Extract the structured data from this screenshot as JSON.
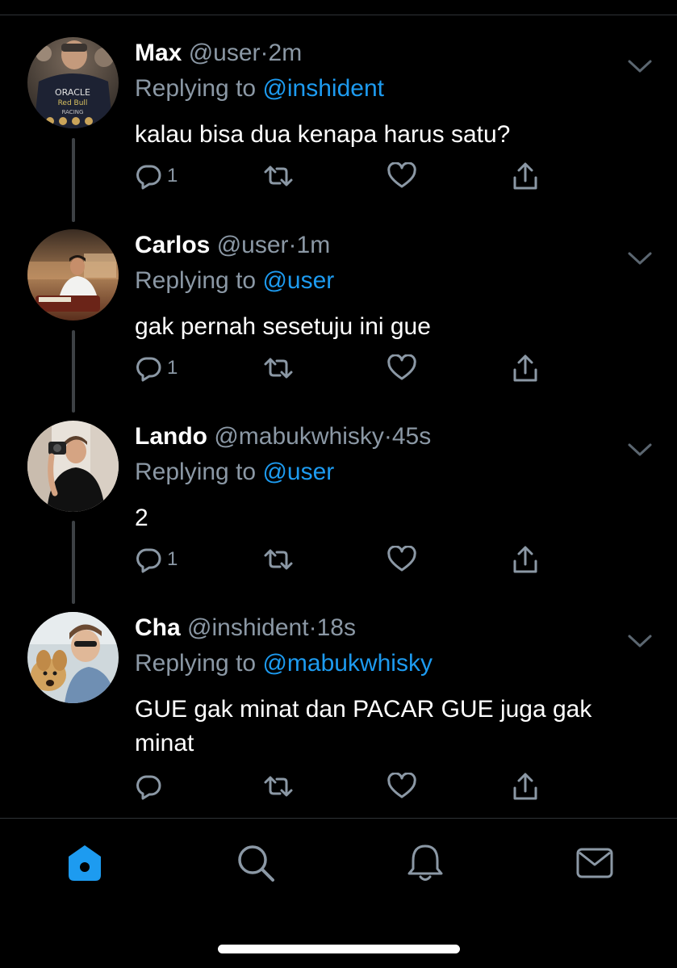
{
  "tweets": [
    {
      "name": "Max",
      "handle": "@user",
      "separator": "·",
      "time": "2m",
      "replying_prefix": "Replying to ",
      "replying_to": "@inshident",
      "text": "kalau bisa dua kenapa harus satu?",
      "reply_count": "1",
      "avatar": "avatar-max"
    },
    {
      "name": "Carlos",
      "handle": "@user",
      "separator": "·",
      "time": "1m",
      "replying_prefix": "Replying to ",
      "replying_to": "@user",
      "text": "gak pernah sesetuju ini gue",
      "reply_count": "1",
      "avatar": "avatar-carlos"
    },
    {
      "name": "Lando",
      "handle": "@mabukwhisky",
      "separator": "·",
      "time": "45s",
      "replying_prefix": "Replying to ",
      "replying_to": "@user",
      "text": "2",
      "reply_count": "1",
      "avatar": "avatar-lando"
    },
    {
      "name": "Cha",
      "handle": "@inshident",
      "separator": "·",
      "time": "18s",
      "replying_prefix": "Replying to ",
      "replying_to": "@mabukwhisky",
      "text": "GUE gak minat dan PACAR GUE juga gak minat",
      "reply_count": "",
      "avatar": "avatar-cha"
    }
  ],
  "icons": {
    "reply": "reply-icon",
    "retweet": "retweet-icon",
    "like": "heart-icon",
    "share": "share-icon",
    "more": "chevron-down-icon"
  },
  "tabbar": {
    "items": [
      "home-icon",
      "search-icon",
      "notifications-icon",
      "messages-icon"
    ],
    "active": "home-icon"
  },
  "colors": {
    "background": "#000000",
    "text": "#ffffff",
    "secondary": "#8b98a5",
    "accent": "#1d9bf0",
    "divider": "#2f3336"
  }
}
